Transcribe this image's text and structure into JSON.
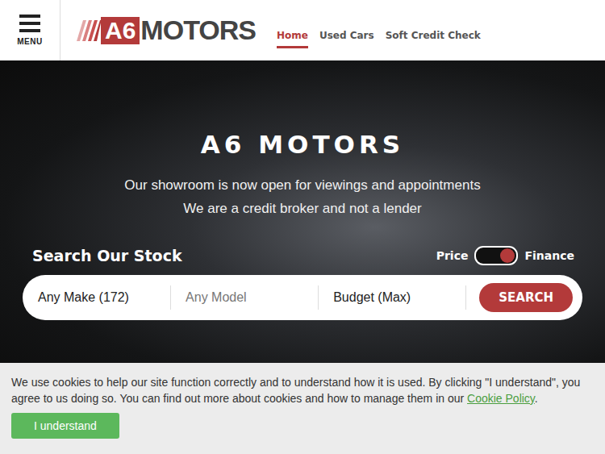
{
  "header": {
    "menu_icon_label": "MENU",
    "logo": {
      "badge": "A6",
      "name": "MOTORS"
    },
    "nav": [
      {
        "label": "Home",
        "selected": true
      },
      {
        "label": "Used Cars",
        "selected": false
      },
      {
        "label": "Soft Credit Check",
        "selected": false
      }
    ]
  },
  "hero": {
    "title": "A6 MOTORS",
    "subtitle": [
      "Our showroom is now open for viewings and appointments",
      "We are a credit broker and not a lender"
    ],
    "search_heading": "Search Our Stock",
    "toggle": {
      "left": "Price",
      "right": "Finance",
      "on": true
    },
    "fields": [
      {
        "text": "Any Make (172)",
        "placeholder": false
      },
      {
        "text": "Any Model",
        "placeholder": true
      },
      {
        "text": "Budget (Max)",
        "placeholder": false
      }
    ],
    "search_button": "SEARCH"
  },
  "cookie_banner": {
    "text": "We use cookies to help our site function correctly and to understand how it is used. By clicking \"I understand\", you agree to us doing so. You can find out more about cookies and how to manage them in our ",
    "link": "Cookie Policy",
    "after": ".",
    "button": "I understand"
  }
}
